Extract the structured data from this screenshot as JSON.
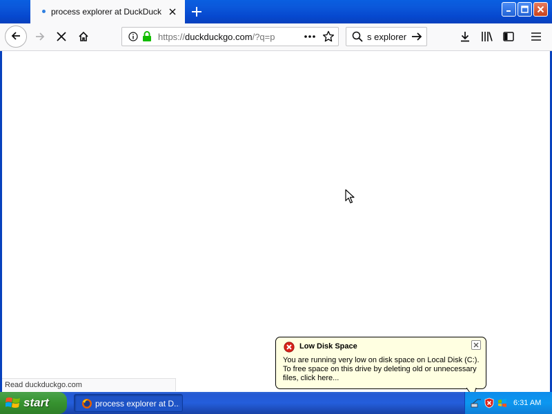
{
  "browser": {
    "tab": {
      "title": "process explorer at DuckDuckGo"
    },
    "url": {
      "scheme": "https://",
      "domain": "duckduckgo.com",
      "rest": "/?q=p"
    },
    "search": {
      "value": "s explorer"
    },
    "status_text": "Read duckduckgo.com"
  },
  "balloon": {
    "title": "Low Disk Space",
    "body": "You are running very low on disk space on Local Disk (C:). To free space on this drive by deleting old or unnecessary files, click here..."
  },
  "taskbar": {
    "start_label": "start",
    "task_label": "process explorer at D...",
    "clock": "6:31 AM"
  },
  "colors": {
    "xp_blue": "#0841bd",
    "start_green": "#36922f",
    "balloon_bg": "#ffffe1",
    "secure_lock": "#12bc00",
    "loading_dot": "#2f7fe0"
  },
  "icons": [
    "close-tab-icon",
    "new-tab-icon",
    "back-arrow-icon",
    "forward-arrow-icon",
    "stop-icon",
    "home-icon",
    "info-icon",
    "lock-icon",
    "page-actions-icon",
    "bookmark-star-icon",
    "search-icon",
    "go-arrow-icon",
    "downloads-icon",
    "library-icon",
    "sidebar-icon",
    "menu-icon",
    "error-icon",
    "windows-logo-icon",
    "firefox-icon",
    "mouse-cursor-icon"
  ]
}
